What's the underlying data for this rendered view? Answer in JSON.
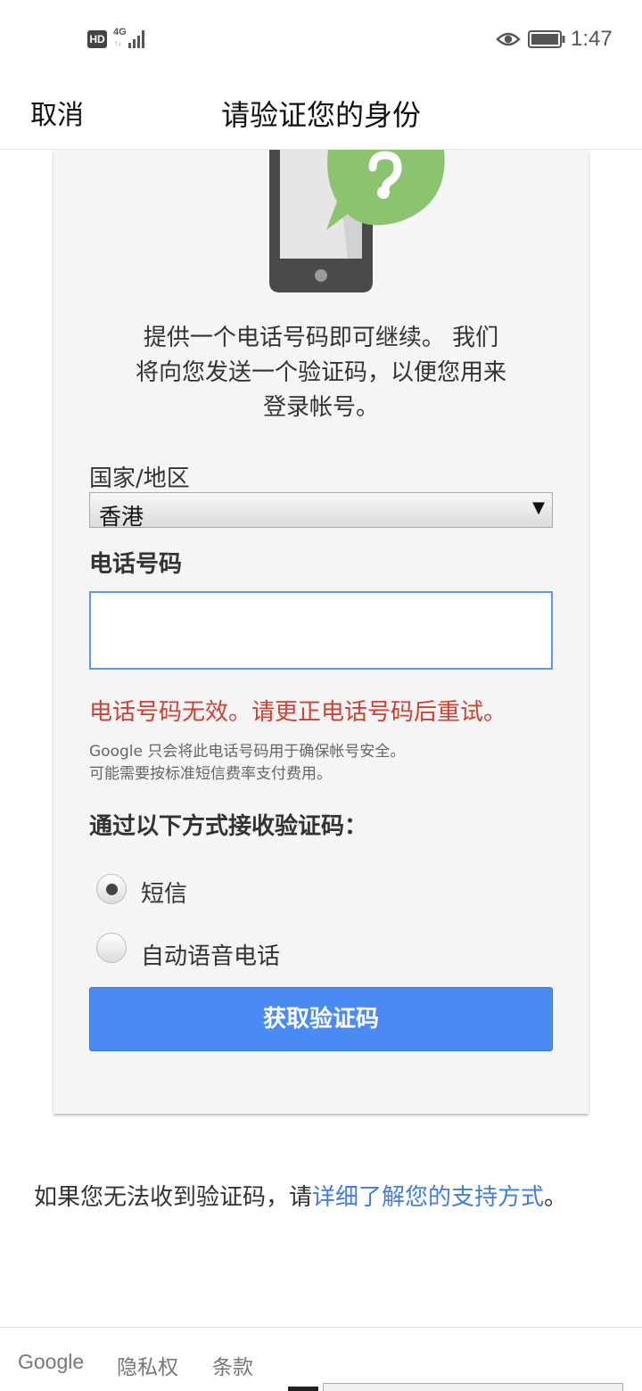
{
  "status_bar": {
    "hd": "HD",
    "network": "4G",
    "network_sub": "↑↓",
    "time": "1:47",
    "icons": [
      "signal-icon",
      "eye-icon",
      "battery-icon"
    ]
  },
  "header": {
    "cancel": "取消",
    "title": "请验证您的身份"
  },
  "card": {
    "intro_lines": [
      "提供一个电话号码即可继续。 我们",
      "将向您发送一个验证码，以便您用来",
      "登录帐号。"
    ],
    "country_label": "国家/地区",
    "country_value": "香港",
    "phone_label": "电话号码",
    "phone_value": "",
    "error": "电话号码无效。请更正电话号码后重试。",
    "hint_lines": [
      "Google 只会将此电话号码用于确保帐号安全。",
      "可能需要按标准短信费率支付费用。"
    ],
    "method_heading": "通过以下方式接收验证码：",
    "methods": [
      {
        "label": "短信",
        "selected": true
      },
      {
        "label": "自动语音电话",
        "selected": false
      }
    ],
    "button": "获取验证码"
  },
  "support": {
    "prefix": "如果您无法收到验证码，请",
    "link": "详细了解您的支持方式",
    "suffix": "。"
  },
  "footer": {
    "links": [
      "Google",
      "隐私权",
      "条款"
    ]
  },
  "colors": {
    "accent": "#4a8af4",
    "error": "#d23f31",
    "link": "#3f7de0",
    "bubble": "#8cc36f"
  }
}
